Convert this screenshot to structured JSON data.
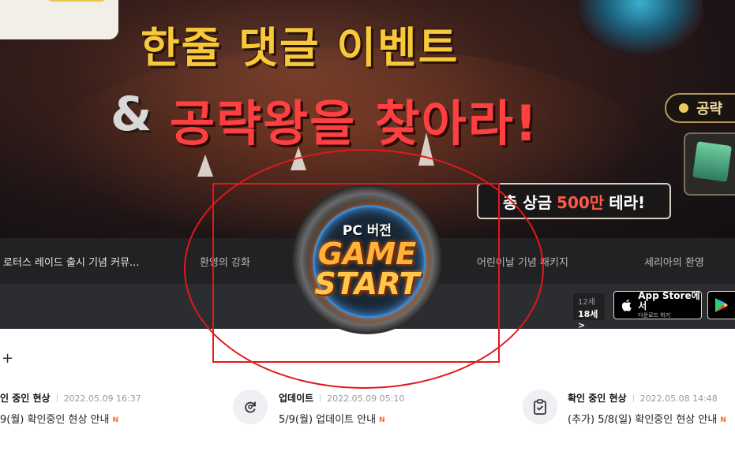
{
  "hero": {
    "title_line1": "한줄 댓글 이벤트",
    "amp": "&",
    "title_line2": "공략왕을 찾아라!",
    "prize_prefix": "총 상금",
    "prize_amount": "500만",
    "prize_suffix": "테라!",
    "tag_label": "공략"
  },
  "nav": {
    "items": [
      {
        "label": "로터스 레이드 출시 기념 커뮤..."
      },
      {
        "label": "환영의 강화"
      },
      {
        "label": "어린이날 기념 패키지"
      },
      {
        "label": "세리아의 환영"
      }
    ]
  },
  "badge": {
    "pc_label": "PC 버전",
    "game": "GAME",
    "start": "START"
  },
  "store": {
    "age_small": "12세",
    "age_main": "18세 >",
    "appstore_line1": "App Store에서",
    "appstore_line2": "다운로드 하기"
  },
  "notices": {
    "plus_label": "+",
    "items": [
      {
        "category": "인 중인 현상",
        "date": "2022.05.09 16:37",
        "title": "9(월) 확인중인 현상 안내",
        "new": "N",
        "icon": "none"
      },
      {
        "category": "업데이트",
        "date": "2022.05.09 05:10",
        "title": "5/9(월) 업데이트 안내",
        "new": "N",
        "icon": "refresh-icon"
      },
      {
        "category": "확인 중인 현상",
        "date": "2022.05.08 14:48",
        "title": "(추가) 5/8(일) 확인중인 현상 안내",
        "new": "N",
        "icon": "clipboard-check-icon"
      }
    ]
  },
  "colors": {
    "annotation": "#e0191b",
    "title_yellow": "#f7c83a",
    "title_red": "#ff4040",
    "new_badge": "#ff6a1a"
  }
}
